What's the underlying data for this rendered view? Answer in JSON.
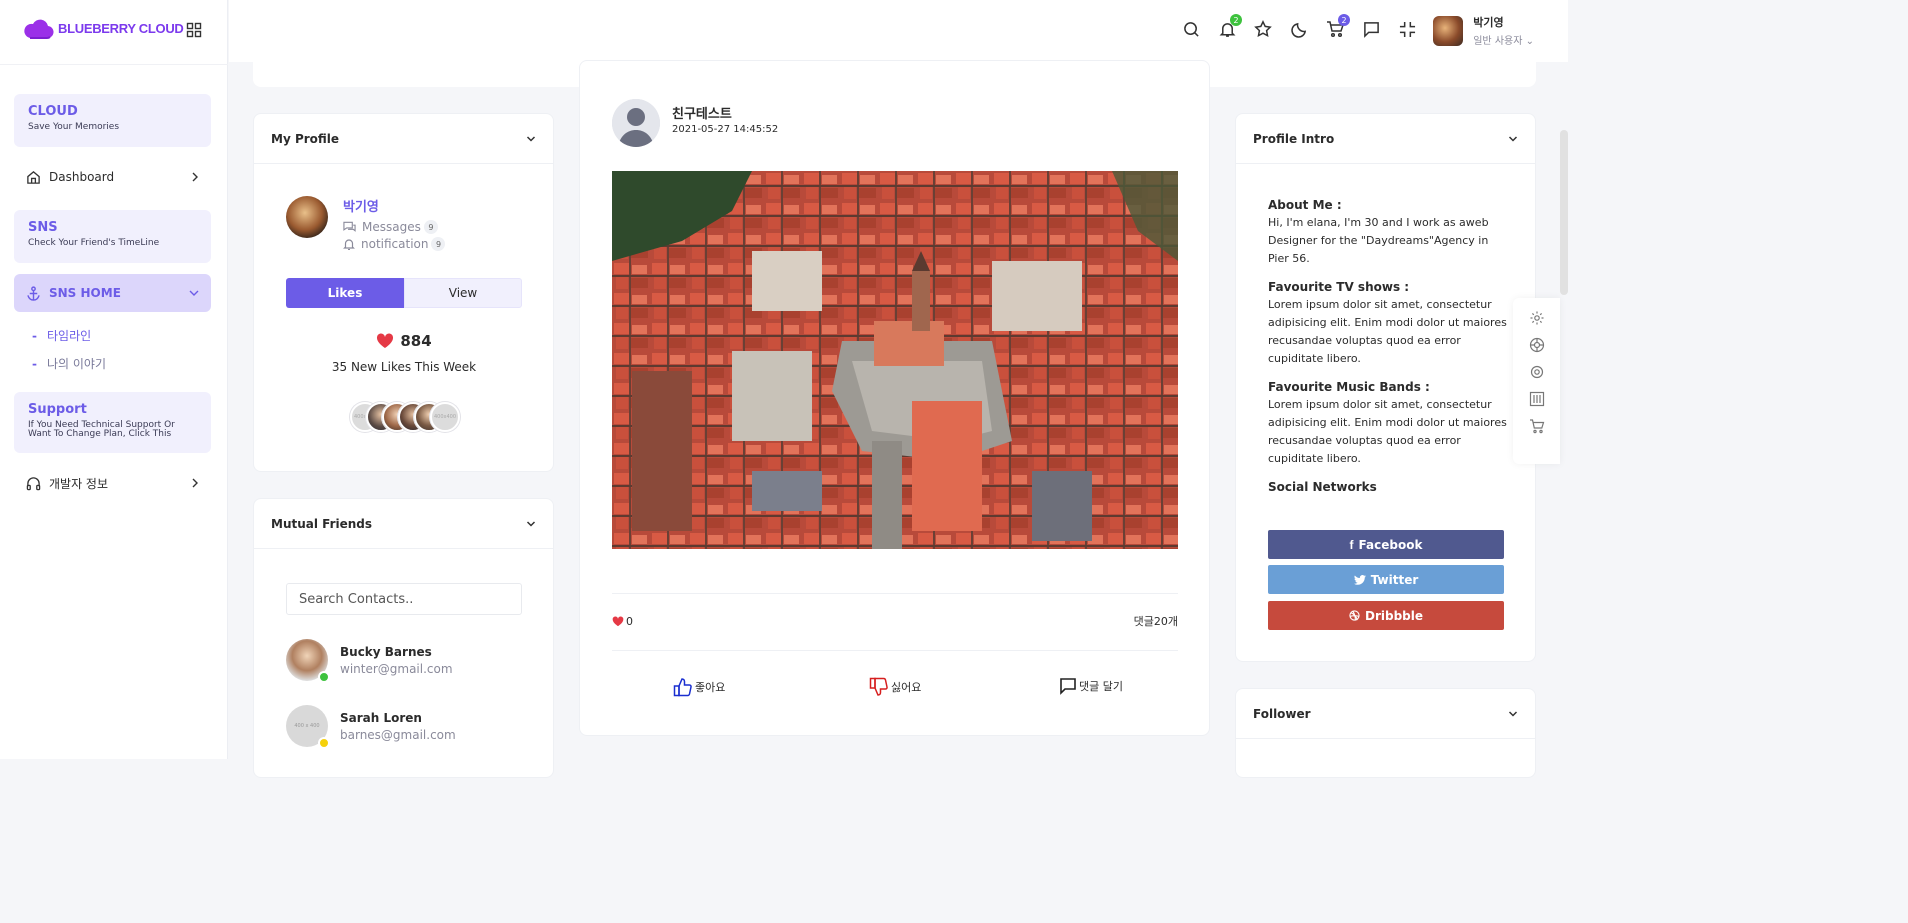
{
  "brand": {
    "name": "BLUEBERRY CLOUD",
    "accent": "#6c5ce7",
    "logo_color": "#7c3aed"
  },
  "sidebar": {
    "cloud_card": {
      "title": "CLOUD",
      "subtitle": "Save Your Memories"
    },
    "dashboard": {
      "label": "Dashboard",
      "icon": "home-icon"
    },
    "sns_card": {
      "title": "SNS",
      "subtitle": "Check Your Friend's TimeLine"
    },
    "sns_home": {
      "label": "SNS HOME",
      "icon": "anchor-icon"
    },
    "sub_items": [
      {
        "label": "타임라인"
      },
      {
        "label": "나의 이야기"
      }
    ],
    "support_card": {
      "title": "Support",
      "subtitle_line1": "If You Need Technical Support Or",
      "subtitle_line2": "Want To Change Plan, Click This"
    },
    "dev_info": {
      "label": "개발자 정보",
      "icon": "headphones-icon"
    }
  },
  "topbar": {
    "icons": [
      "search-icon",
      "bell-icon",
      "star-icon",
      "moon-icon",
      "cart-icon",
      "message-icon",
      "compress-icon"
    ],
    "notification_count": "2",
    "cart_count": "2",
    "user": {
      "name": "박기영",
      "role": "일반 사용자"
    }
  },
  "my_profile": {
    "header": "My Profile",
    "name": "박기영",
    "messages_label": "Messages",
    "messages_count": "9",
    "notification_label": "notification",
    "notification_count": "9",
    "likes_button": "Likes",
    "view_button": "View",
    "likes_count": "884",
    "likes_subtitle": "35 New Likes This Week",
    "placeholder_left": "400x400",
    "placeholder_right": "400x400"
  },
  "mutual_friends": {
    "header": "Mutual Friends",
    "search_placeholder": "Search Contacts..",
    "friends": [
      {
        "name": "Bucky Barnes",
        "email": "winter@gmail.com",
        "status_color": "#3ec23e"
      },
      {
        "name": "Sarah Loren",
        "email": "barnes@gmail.com",
        "status_color": "#f5d10b",
        "avatar_text": "400 x 400"
      }
    ]
  },
  "post": {
    "author": "친구테스트",
    "date": "2021-05-27 14:45:52",
    "likes": "0",
    "comments": "댓글20개",
    "actions": {
      "like": "좋아요",
      "dislike": "싫어요",
      "comment": "댓글 달기"
    }
  },
  "profile_intro": {
    "header": "Profile Intro",
    "about_title": "About Me :",
    "about_text": "Hi, I'm elana, I'm 30 and I work as aweb Designer for the \"Daydreams\"Agency in Pier 56.",
    "tv_title": "Favourite TV shows :",
    "tv_text": "Lorem ipsum dolor sit amet, consectetur adipisicing elit. Enim modi dolor ut maiores recusandae voluptas quod ea error cupiditate libero.",
    "music_title": "Favourite Music Bands :",
    "music_text": "Lorem ipsum dolor sit amet, consectetur adipisicing elit. Enim modi dolor ut maiores recusandae voluptas quod ea error cupiditate libero.",
    "social_title": "Social Networks",
    "facebook": "Facebook",
    "twitter": "Twitter",
    "dribbble": "Dribbble"
  },
  "follower": {
    "header": "Follower"
  },
  "customizer_icons": [
    "gear-icon",
    "palette-icon",
    "gear-icon",
    "sliders-icon",
    "cart-icon"
  ]
}
